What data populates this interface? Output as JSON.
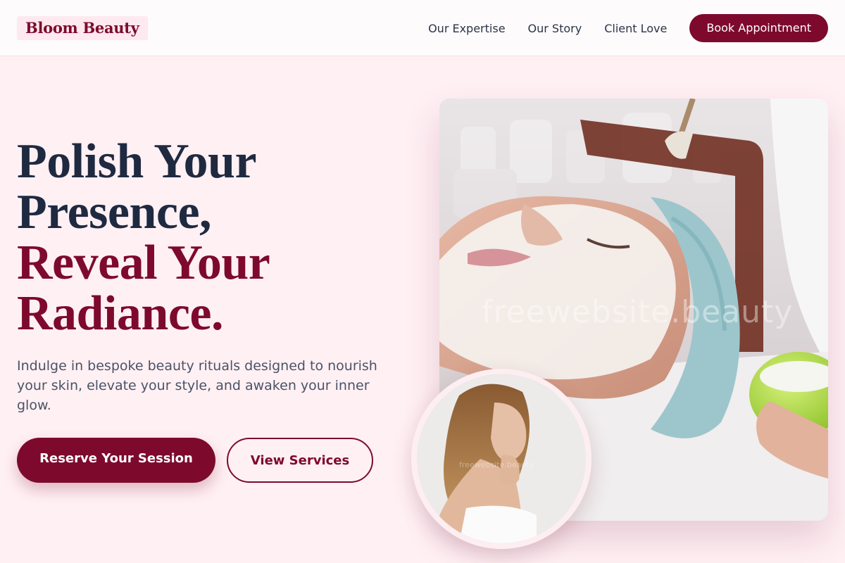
{
  "header": {
    "brand": "Bloom Beauty",
    "nav": [
      "Our Expertise",
      "Our Story",
      "Client Love"
    ],
    "cta": "Book Appointment"
  },
  "hero": {
    "headline_line1": "Polish Your",
    "headline_line2": "Presence,",
    "headline_line3": "Reveal Your",
    "headline_line4": "Radiance.",
    "subtext": "Indulge in bespoke beauty rituals designed to nourish your skin, elevate your style, and awaken your inner glow.",
    "primary_button": "Reserve Your Session",
    "secondary_button": "View Services",
    "image_watermark": "freewebsite.beauty",
    "portrait_watermark": "freewebsite.beauty"
  },
  "colors": {
    "brand": "#7d0a2d",
    "heading": "#1f2a40",
    "background": "#fff0f4",
    "text_muted": "#4a5366"
  }
}
